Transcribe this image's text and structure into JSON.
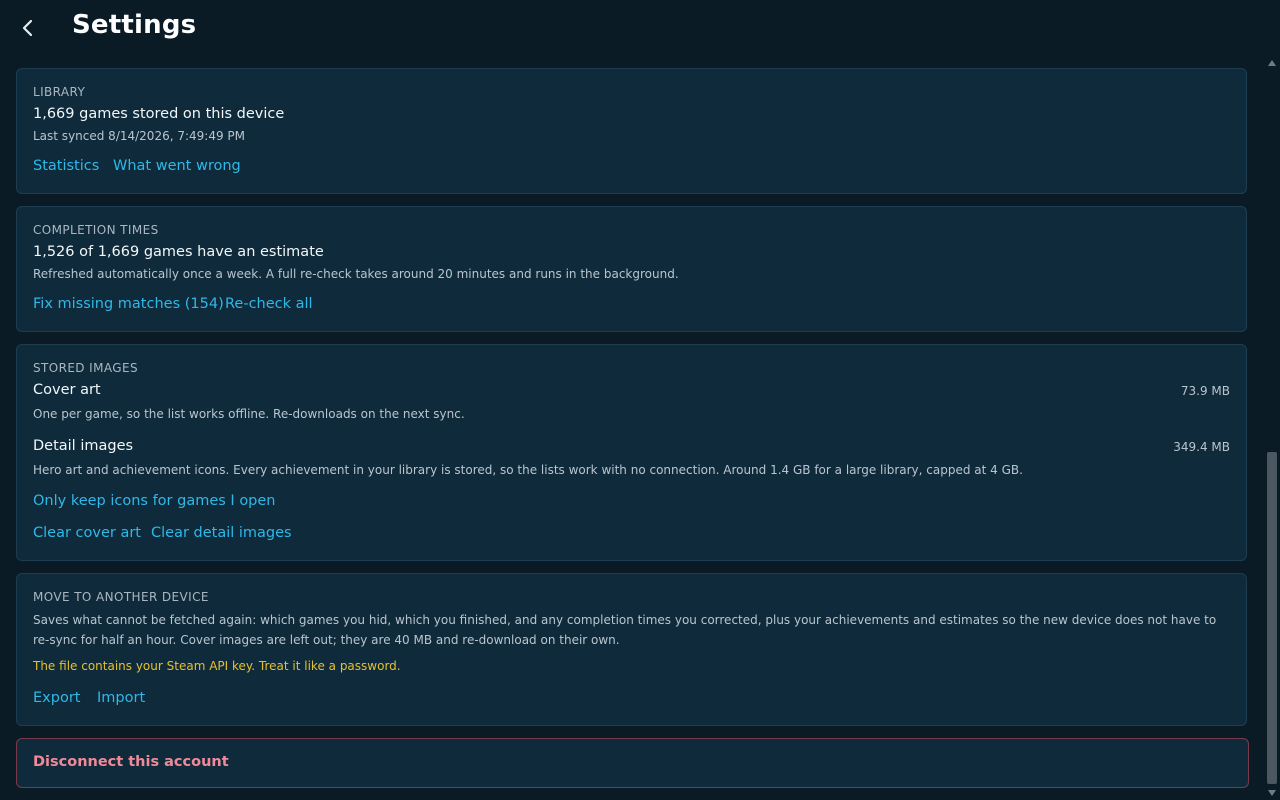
{
  "header": {
    "title": "Settings"
  },
  "library": {
    "label": "LIBRARY",
    "summary": "1,669 games stored on this device",
    "last_synced": "Last synced 8/14/2026, 7:49:49 PM",
    "links": {
      "statistics": "Statistics",
      "what_went_wrong": "What went wrong"
    }
  },
  "completion": {
    "label": "COMPLETION TIMES",
    "summary": "1,526 of 1,669 games have an estimate",
    "note": "Refreshed automatically once a week. A full re-check takes around 20 minutes and runs in the background.",
    "links": {
      "fix_missing": "Fix missing matches (154)",
      "recheck_all": "Re-check all"
    }
  },
  "images": {
    "label": "STORED IMAGES",
    "cover": {
      "title": "Cover art",
      "size": "73.9 MB",
      "note": "One per game, so the list works offline. Re-downloads on the next sync."
    },
    "detail": {
      "title": "Detail images",
      "size": "349.4 MB",
      "note": "Hero art and achievement icons. Every achievement in your library is stored, so the lists work with no connection. Around 1.4 GB for a large library, capped at 4 GB."
    },
    "links": {
      "only_keep": "Only keep icons for games I open",
      "clear_cover": "Clear cover art",
      "clear_detail": "Clear detail images"
    }
  },
  "move": {
    "label": "MOVE TO ANOTHER DEVICE",
    "note": "Saves what cannot be fetched again: which games you hid, which you finished, and any completion times you corrected, plus your achievements and estimates so the new device does not have to re-sync for half an hour. Cover images are left out; they are 40 MB and re-download on their own.",
    "warning": "The file contains your Steam API key. Treat it like a password.",
    "links": {
      "export": "Export",
      "import": "Import"
    }
  },
  "disconnect": {
    "label": "Disconnect this account"
  },
  "colors": {
    "background": "#0b1b25",
    "card": "#0f2a3a",
    "link": "#2fb8e8",
    "warning": "#e6c02e",
    "danger": "#f08a9a"
  }
}
